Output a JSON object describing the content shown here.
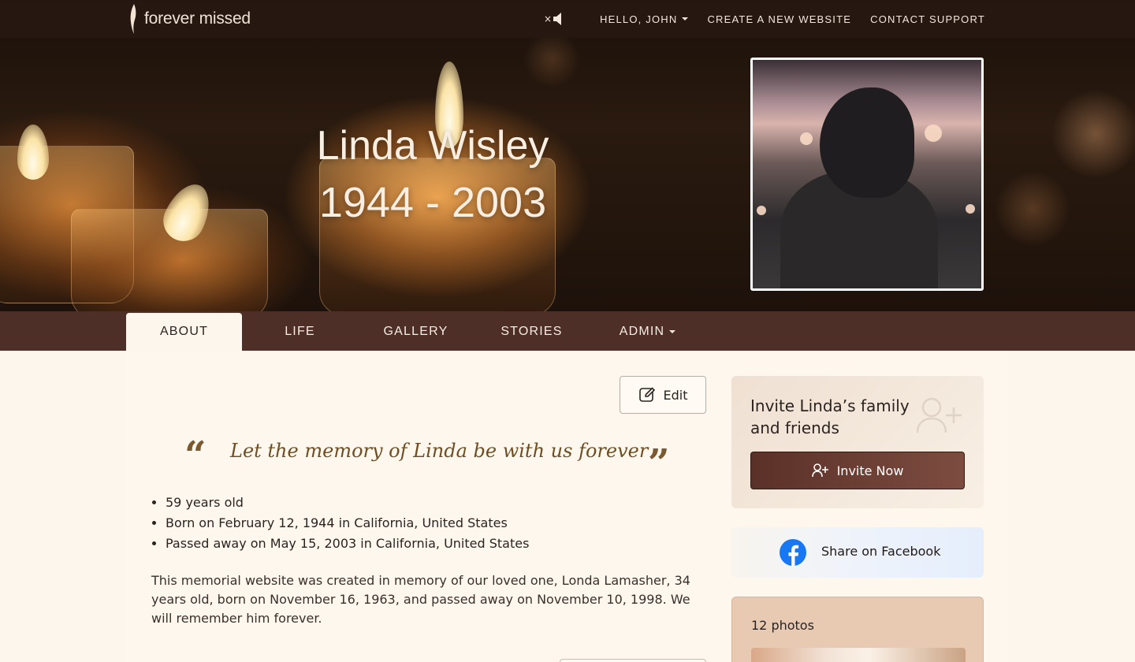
{
  "brand": {
    "name": "forever missed"
  },
  "topnav": {
    "mute_label": "×",
    "greeting": "HELLO, JOHN",
    "create_link": "CREATE A NEW WEBSITE",
    "support_link": "CONTACT SUPPORT"
  },
  "hero": {
    "name": "Linda Wisley",
    "dates": "1944 - 2003"
  },
  "tabs": [
    {
      "label": "ABOUT",
      "active": true
    },
    {
      "label": "LIFE"
    },
    {
      "label": "GALLERY"
    },
    {
      "label": "STORIES"
    },
    {
      "label": "ADMIN"
    }
  ],
  "about": {
    "edit_label": "Edit",
    "quote": "Let the memory of Linda be with us forever",
    "quote_open": "“",
    "quote_close": "”",
    "facts": [
      "59 years old",
      "Born on February 12, 1944 in California, United States",
      "Passed away on May 15, 2003 in California, United States"
    ],
    "bio": "This memorial website was created in memory of our loved one, Londa Lamasher, 34 years old, born on November 16, 1963, and passed away on November 10, 1998. We will remember him forever."
  },
  "sidebar": {
    "invite_title": "Invite Linda’s family and friends",
    "invite_button": "Invite Now",
    "facebook_label": "Share on Facebook",
    "photos_count": "12 photos"
  },
  "colors": {
    "tabbar": "#4e2f27",
    "invite_button": "#6b3d33",
    "facebook_blue": "#1877f2",
    "quote_text": "#6e4f25"
  },
  "icons": {
    "logo": "flame-icon",
    "mute": "speaker-mute-icon",
    "edit": "edit-icon",
    "invite": "user-plus-icon",
    "facebook": "facebook-icon"
  }
}
